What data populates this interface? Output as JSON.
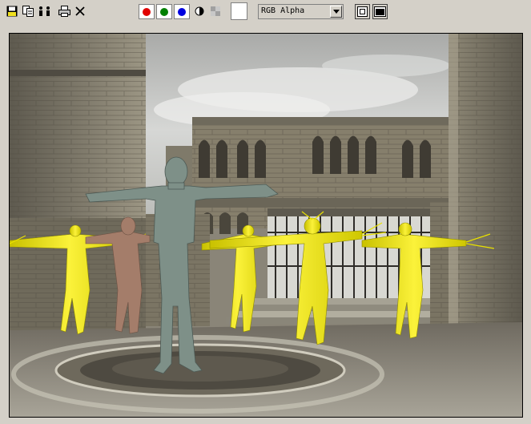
{
  "toolbar": {
    "icons": [
      "save-icon",
      "copy-icon",
      "clone-icon",
      "print-icon",
      "close-icon"
    ],
    "channels": [
      {
        "name": "red-channel",
        "color": "#e00000"
      },
      {
        "name": "green-channel",
        "color": "#008000"
      },
      {
        "name": "blue-channel",
        "color": "#0000e0"
      }
    ],
    "display_mode_select": "RGB Alpha",
    "background_swatch_color": "#ffffff"
  },
  "viewport": {
    "subject_colors": {
      "sky": "#c7c9c8",
      "stone": "#8b8574",
      "grey_figure": "#7e9088",
      "brown_figure": "#a47d6a",
      "yellow_figures": "#f1ea10"
    }
  }
}
